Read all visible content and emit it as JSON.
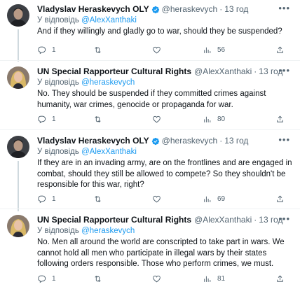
{
  "reply_prefix": "У відповідь",
  "tweets": [
    {
      "name": "Vladyslav Heraskevych OLY",
      "handle": "@heraskevych",
      "time": "13 год",
      "reply_to": "@AlexXanthaki",
      "text": "And if they willingly and gladly go to war, should they be suspended?",
      "replies": "1",
      "views": "56",
      "avatar": "dark-portrait"
    },
    {
      "name": "UN Special Rapporteur Cultural Rights",
      "handle": "@AlexXanthaki",
      "time": "13 год",
      "reply_to": "@heraskevych",
      "text": "No. They should be suspended if they committed crimes against humanity, war crimes, genocide or propaganda for war.",
      "replies": "1",
      "views": "80",
      "avatar": "blonde-portrait"
    },
    {
      "name": "Vladyslav Heraskevych OLY",
      "handle": "@heraskevych",
      "time": "13 год",
      "reply_to": "@AlexXanthaki",
      "text": "If they are in an invading army, are on the frontlines and are engaged in combat, should they still be allowed to compete? So they shouldn't be responsible for this war, right?",
      "replies": "1",
      "views": "69",
      "avatar": "dark-portrait"
    },
    {
      "name": "UN Special Rapporteur Cultural Rights",
      "handle": "@AlexXanthaki",
      "time": "13 год",
      "reply_to": "@heraskevych",
      "text": "No. Men all around the world are conscripted to take part in wars. We cannot hold all men who participate in illegal wars by their states following orders responsible. Those who perform crimes, we must.",
      "replies": "1",
      "views": "81",
      "avatar": "blonde-portrait"
    }
  ],
  "icons": {
    "more": "more-icon",
    "reply": "reply-icon",
    "retweet": "retweet-icon",
    "like": "like-icon",
    "views": "views-icon",
    "share": "share-icon",
    "verified": "verified-badge-icon"
  },
  "colors": {
    "accent": "#1d9bf0",
    "muted": "#536471",
    "text": "#0f1419",
    "thread_line": "#cfd9de"
  }
}
